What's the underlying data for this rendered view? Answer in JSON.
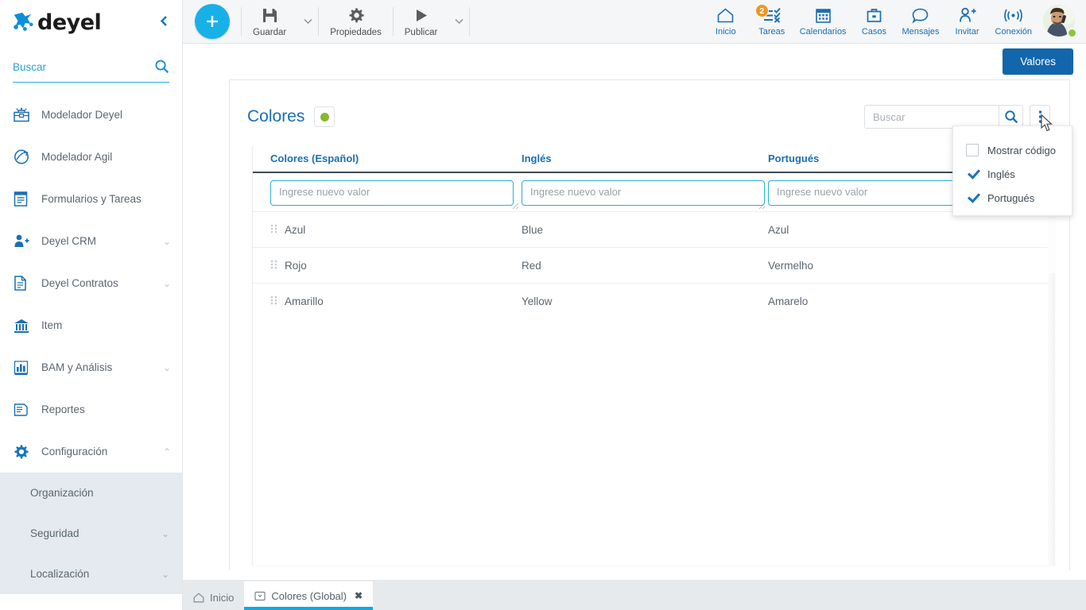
{
  "brand": {
    "logo_text": "deyel",
    "accent_blue": "#1a6fb5",
    "accent_cyan": "#17b1e8",
    "button_blue": "#1266ac",
    "badge_orange": "#f0971d",
    "status_green": "#8cb62e"
  },
  "sidebar": {
    "collapse_icon": "chevron-left-icon",
    "search": {
      "placeholder": "Buscar",
      "value": "",
      "icon": "search-icon"
    },
    "items": [
      {
        "label": "Modelador Deyel",
        "icon": "toolbox-icon",
        "chevron": ""
      },
      {
        "label": "Modelador Agil",
        "icon": "agile-icon",
        "chevron": ""
      },
      {
        "label": "Formularios y Tareas",
        "icon": "form-icon",
        "chevron": ""
      },
      {
        "label": "Deyel CRM",
        "icon": "crm-icon",
        "chevron": "⌄"
      },
      {
        "label": "Deyel Contratos",
        "icon": "document-icon",
        "chevron": "⌄"
      },
      {
        "label": "Item",
        "icon": "bank-icon",
        "chevron": ""
      },
      {
        "label": "BAM y Análisis",
        "icon": "bar-chart-icon",
        "chevron": "⌄"
      },
      {
        "label": "Reportes",
        "icon": "report-icon",
        "chevron": ""
      },
      {
        "label": "Configuración",
        "icon": "gear-icon",
        "chevron": "⌃"
      }
    ],
    "subitems": [
      {
        "label": "Organización",
        "chevron": ""
      },
      {
        "label": "Seguridad",
        "chevron": "⌄"
      },
      {
        "label": "Localización",
        "chevron": "⌄"
      }
    ]
  },
  "toolbar": {
    "add_label": "+",
    "add_icon": "plus-icon",
    "tools": [
      {
        "label": "Guardar",
        "icon": "save-icon",
        "has_caret": true
      },
      {
        "label": "Propiedades",
        "icon": "gear-icon",
        "has_caret": false
      },
      {
        "label": "Publicar",
        "icon": "play-icon",
        "has_caret": true
      }
    ]
  },
  "topnav": {
    "items": [
      {
        "label": "Inicio",
        "icon": "home-icon",
        "badge": ""
      },
      {
        "label": "Tareas",
        "icon": "tasks-icon",
        "badge": "2"
      },
      {
        "label": "Calendarios",
        "icon": "calendar-icon",
        "badge": ""
      },
      {
        "label": "Casos",
        "icon": "briefcase-icon",
        "badge": ""
      },
      {
        "label": "Mensajes",
        "icon": "chat-icon",
        "badge": ""
      },
      {
        "label": "Invitar",
        "icon": "user-plus-icon",
        "badge": ""
      },
      {
        "label": "Conexión",
        "icon": "signal-icon",
        "badge": ""
      }
    ],
    "avatar": {
      "name": "avatar",
      "status": "online"
    }
  },
  "content": {
    "valores_button": "Valores",
    "panel": {
      "title": "Colores",
      "status_dot_color": "#8cb62e",
      "search": {
        "placeholder": "Buscar",
        "value": "",
        "icon": "search-icon"
      },
      "kebab_icon": "more-vertical-icon"
    },
    "table": {
      "columns": [
        "Colores (Español)",
        "Inglés",
        "Portugués"
      ],
      "new_row_placeholders": [
        "Ingrese nuevo valor",
        "Ingrese nuevo valor",
        "Ingrese nuevo valor"
      ],
      "new_row_values": [
        "",
        "",
        ""
      ],
      "rows": [
        {
          "es": "Azul",
          "en": "Blue",
          "pt": "Azul"
        },
        {
          "es": "Rojo",
          "en": "Red",
          "pt": "Vermelho"
        },
        {
          "es": "Amarillo",
          "en": "Yellow",
          "pt": "Amarelo"
        }
      ]
    },
    "kebab_menu": {
      "items": [
        {
          "label": "Mostrar código",
          "checked": false
        },
        {
          "label": "Inglés",
          "checked": true
        },
        {
          "label": "Portugués",
          "checked": true
        }
      ]
    }
  },
  "tabbar": {
    "tabs": [
      {
        "label": "Inicio",
        "icon": "home-icon",
        "active": false,
        "closable": false
      },
      {
        "label": "Colores (Global)",
        "icon": "window-icon",
        "active": true,
        "closable": true,
        "close_glyph": "✖"
      }
    ]
  }
}
